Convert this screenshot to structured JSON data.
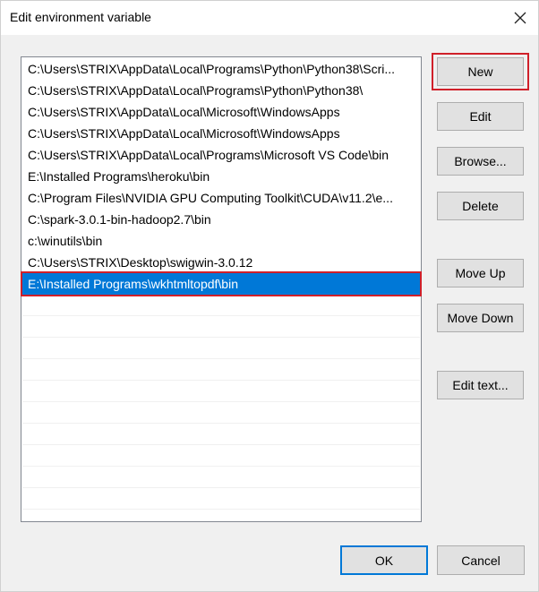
{
  "window": {
    "title": "Edit environment variable",
    "close_icon": "close-icon"
  },
  "paths": [
    "C:\\Users\\STRIX\\AppData\\Local\\Programs\\Python\\Python38\\Scri...",
    "C:\\Users\\STRIX\\AppData\\Local\\Programs\\Python\\Python38\\",
    "C:\\Users\\STRIX\\AppData\\Local\\Microsoft\\WindowsApps",
    "C:\\Users\\STRIX\\AppData\\Local\\Microsoft\\WindowsApps",
    "C:\\Users\\STRIX\\AppData\\Local\\Programs\\Microsoft VS Code\\bin",
    "E:\\Installed Programs\\heroku\\bin",
    "C:\\Program Files\\NVIDIA GPU Computing Toolkit\\CUDA\\v11.2\\e...",
    "C:\\spark-3.0.1-bin-hadoop2.7\\bin",
    "c:\\winutils\\bin",
    "C:\\Users\\STRIX\\Desktop\\swigwin-3.0.12",
    "E:\\Installed Programs\\wkhtmltopdf\\bin"
  ],
  "selected_index": 10,
  "buttons": {
    "new": "New",
    "edit": "Edit",
    "browse": "Browse...",
    "delete": "Delete",
    "move_up": "Move Up",
    "move_down": "Move Down",
    "edit_text": "Edit text...",
    "ok": "OK",
    "cancel": "Cancel"
  },
  "colors": {
    "selection": "#0078d7",
    "highlight": "#d0202a",
    "default_button_border": "#0078d7"
  }
}
